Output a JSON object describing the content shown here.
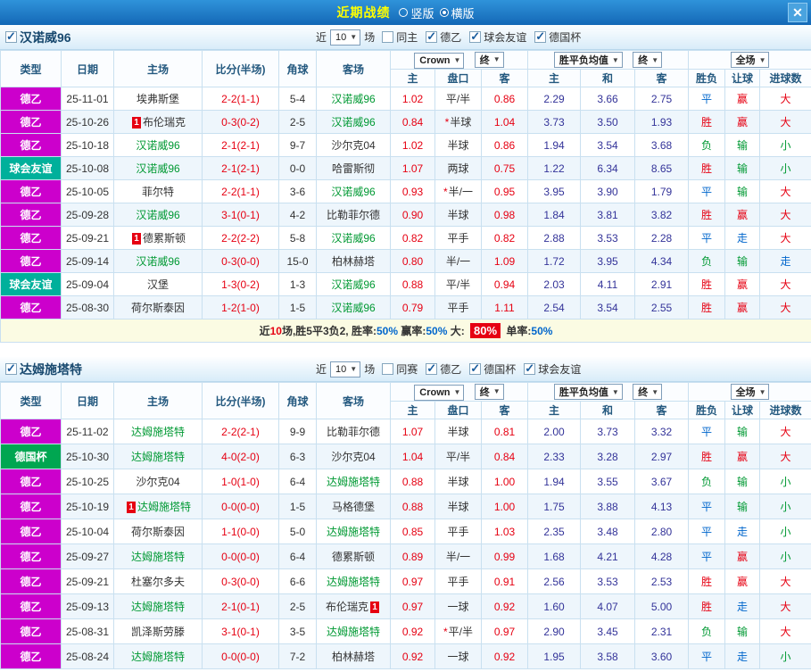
{
  "topbar": {
    "title": "近期战绩",
    "layout_options": [
      {
        "label": "竖版",
        "selected": false
      },
      {
        "label": "横版",
        "selected": true
      }
    ],
    "close": "✕"
  },
  "columns": {
    "type": "类型",
    "date": "日期",
    "home": "主场",
    "score": "比分(半场)",
    "corner": "角球",
    "away": "客场",
    "odds_group": "Crown",
    "odds_end": "终",
    "avg_group": "胜平负均值",
    "avg_end": "终",
    "full_group": "全场",
    "odds_sub": [
      "主",
      "盘口",
      "客"
    ],
    "avg_sub": [
      "主",
      "和",
      "客"
    ],
    "full_sub": [
      "胜负",
      "让球",
      "进球数"
    ]
  },
  "type_colors": {
    "德乙": "#cc00cc",
    "球会友谊": "#00b09b",
    "德国杯": "#00a651"
  },
  "result_colors": {
    "胜": "#e60012",
    "平": "#0066cc",
    "负": "#009933",
    "赢": "#e60012",
    "输": "#009933",
    "走": "#0066cc",
    "大": "#e60012",
    "小": "#009933"
  },
  "sections": [
    {
      "team": "汉诺威96",
      "near": "近",
      "count": "10",
      "games": "场",
      "filters": [
        {
          "label": "同主",
          "checked": false
        },
        {
          "label": "德乙",
          "checked": true
        },
        {
          "label": "球会友谊",
          "checked": true
        },
        {
          "label": "德国杯",
          "checked": true
        }
      ],
      "rows": [
        {
          "type": "德乙",
          "date": "25-11-01",
          "home": "埃弗斯堡",
          "home_team": false,
          "home_card": false,
          "score": "2-2(1-1)",
          "corner": "5-4",
          "away": "汉诺威96",
          "away_team": true,
          "away_card": false,
          "o1": "1.02",
          "star": false,
          "pan": "平/半",
          "o2": "0.86",
          "a1": "2.29",
          "a2": "3.66",
          "a3": "2.75",
          "r1": "平",
          "r2": "赢",
          "r3": "大"
        },
        {
          "type": "德乙",
          "date": "25-10-26",
          "home": "布伦瑞克",
          "home_team": false,
          "home_card": true,
          "score": "0-3(0-2)",
          "corner": "2-5",
          "away": "汉诺威96",
          "away_team": true,
          "away_card": false,
          "o1": "0.84",
          "star": true,
          "pan": "半球",
          "o2": "1.04",
          "a1": "3.73",
          "a2": "3.50",
          "a3": "1.93",
          "r1": "胜",
          "r2": "赢",
          "r3": "大"
        },
        {
          "type": "德乙",
          "date": "25-10-18",
          "home": "汉诺威96",
          "home_team": true,
          "home_card": false,
          "score": "2-1(2-1)",
          "corner": "9-7",
          "away": "沙尔克04",
          "away_team": false,
          "away_card": false,
          "o1": "1.02",
          "star": false,
          "pan": "半球",
          "o2": "0.86",
          "a1": "1.94",
          "a2": "3.54",
          "a3": "3.68",
          "r1": "负",
          "r2": "输",
          "r3": "小"
        },
        {
          "type": "球会友谊",
          "date": "25-10-08",
          "home": "汉诺威96",
          "home_team": true,
          "home_card": false,
          "score": "2-1(2-1)",
          "corner": "0-0",
          "away": "哈雷斯彻",
          "away_team": false,
          "away_card": false,
          "o1": "1.07",
          "star": false,
          "pan": "两球",
          "o2": "0.75",
          "a1": "1.22",
          "a2": "6.34",
          "a3": "8.65",
          "r1": "胜",
          "r2": "输",
          "r3": "小"
        },
        {
          "type": "德乙",
          "date": "25-10-05",
          "home": "菲尔特",
          "home_team": false,
          "home_card": false,
          "score": "2-2(1-1)",
          "corner": "3-6",
          "away": "汉诺威96",
          "away_team": true,
          "away_card": false,
          "o1": "0.93",
          "star": true,
          "pan": "半/一",
          "o2": "0.95",
          "a1": "3.95",
          "a2": "3.90",
          "a3": "1.79",
          "r1": "平",
          "r2": "输",
          "r3": "大"
        },
        {
          "type": "德乙",
          "date": "25-09-28",
          "home": "汉诺威96",
          "home_team": true,
          "home_card": false,
          "score": "3-1(0-1)",
          "corner": "4-2",
          "away": "比勒菲尔德",
          "away_team": false,
          "away_card": false,
          "o1": "0.90",
          "star": false,
          "pan": "半球",
          "o2": "0.98",
          "a1": "1.84",
          "a2": "3.81",
          "a3": "3.82",
          "r1": "胜",
          "r2": "赢",
          "r3": "大"
        },
        {
          "type": "德乙",
          "date": "25-09-21",
          "home": "德累斯顿",
          "home_team": false,
          "home_card": true,
          "score": "2-2(2-2)",
          "corner": "5-8",
          "away": "汉诺威96",
          "away_team": true,
          "away_card": false,
          "o1": "0.82",
          "star": false,
          "pan": "平手",
          "o2": "0.82",
          "a1": "2.88",
          "a2": "3.53",
          "a3": "2.28",
          "r1": "平",
          "r2": "走",
          "r3": "大"
        },
        {
          "type": "德乙",
          "date": "25-09-14",
          "home": "汉诺威96",
          "home_team": true,
          "home_card": false,
          "score": "0-3(0-0)",
          "corner": "15-0",
          "away": "柏林赫塔",
          "away_team": false,
          "away_card": false,
          "o1": "0.80",
          "star": false,
          "pan": "半/一",
          "o2": "1.09",
          "a1": "1.72",
          "a2": "3.95",
          "a3": "4.34",
          "r1": "负",
          "r2": "输",
          "r3": "走"
        },
        {
          "type": "球会友谊",
          "date": "25-09-04",
          "home": "汉堡",
          "home_team": false,
          "home_card": false,
          "score": "1-3(0-2)",
          "corner": "1-3",
          "away": "汉诺威96",
          "away_team": true,
          "away_card": false,
          "o1": "0.88",
          "star": false,
          "pan": "平/半",
          "o2": "0.94",
          "a1": "2.03",
          "a2": "4.11",
          "a3": "2.91",
          "r1": "胜",
          "r2": "赢",
          "r3": "大"
        },
        {
          "type": "德乙",
          "date": "25-08-30",
          "home": "荷尔斯泰因",
          "home_team": false,
          "home_card": false,
          "score": "1-2(1-0)",
          "corner": "1-5",
          "away": "汉诺威96",
          "away_team": true,
          "away_card": false,
          "o1": "0.79",
          "star": false,
          "pan": "平手",
          "o2": "1.11",
          "a1": "2.54",
          "a2": "3.54",
          "a3": "2.55",
          "r1": "胜",
          "r2": "赢",
          "r3": "大"
        }
      ],
      "summary": {
        "parts": [
          {
            "t": "近"
          },
          {
            "t": "10",
            "c": "red"
          },
          {
            "t": "场,胜5平3负2, 胜率:"
          },
          {
            "t": "50%",
            "c": "blue"
          },
          {
            "t": " 赢率:"
          },
          {
            "t": "50%",
            "c": "blue"
          },
          {
            "t": " 大: "
          },
          {
            "t": "80%",
            "badge": true
          },
          {
            "t": " 单率:"
          },
          {
            "t": "50%",
            "c": "blue"
          }
        ]
      }
    },
    {
      "team": "达姆施塔特",
      "near": "近",
      "count": "10",
      "games": "场",
      "filters": [
        {
          "label": "同赛",
          "checked": false
        },
        {
          "label": "德乙",
          "checked": true
        },
        {
          "label": "德国杯",
          "checked": true
        },
        {
          "label": "球会友谊",
          "checked": true
        }
      ],
      "rows": [
        {
          "type": "德乙",
          "date": "25-11-02",
          "home": "达姆施塔特",
          "home_team": true,
          "home_card": false,
          "score": "2-2(2-1)",
          "corner": "9-9",
          "away": "比勒菲尔德",
          "away_team": false,
          "away_card": false,
          "o1": "1.07",
          "star": false,
          "pan": "半球",
          "o2": "0.81",
          "a1": "2.00",
          "a2": "3.73",
          "a3": "3.32",
          "r1": "平",
          "r2": "输",
          "r3": "大"
        },
        {
          "type": "德国杯",
          "date": "25-10-30",
          "home": "达姆施塔特",
          "home_team": true,
          "home_card": false,
          "score": "4-0(2-0)",
          "corner": "6-3",
          "away": "沙尔克04",
          "away_team": false,
          "away_card": false,
          "o1": "1.04",
          "star": false,
          "pan": "平/半",
          "o2": "0.84",
          "a1": "2.33",
          "a2": "3.28",
          "a3": "2.97",
          "r1": "胜",
          "r2": "赢",
          "r3": "大"
        },
        {
          "type": "德乙",
          "date": "25-10-25",
          "home": "沙尔克04",
          "home_team": false,
          "home_card": false,
          "score": "1-0(1-0)",
          "corner": "6-4",
          "away": "达姆施塔特",
          "away_team": true,
          "away_card": false,
          "o1": "0.88",
          "star": false,
          "pan": "半球",
          "o2": "1.00",
          "a1": "1.94",
          "a2": "3.55",
          "a3": "3.67",
          "r1": "负",
          "r2": "输",
          "r3": "小"
        },
        {
          "type": "德乙",
          "date": "25-10-19",
          "home": "达姆施塔特",
          "home_team": true,
          "home_card": true,
          "score": "0-0(0-0)",
          "corner": "1-5",
          "away": "马格德堡",
          "away_team": false,
          "away_card": false,
          "o1": "0.88",
          "star": false,
          "pan": "半球",
          "o2": "1.00",
          "a1": "1.75",
          "a2": "3.88",
          "a3": "4.13",
          "r1": "平",
          "r2": "输",
          "r3": "小"
        },
        {
          "type": "德乙",
          "date": "25-10-04",
          "home": "荷尔斯泰因",
          "home_team": false,
          "home_card": false,
          "score": "1-1(0-0)",
          "corner": "5-0",
          "away": "达姆施塔特",
          "away_team": true,
          "away_card": false,
          "o1": "0.85",
          "star": false,
          "pan": "平手",
          "o2": "1.03",
          "a1": "2.35",
          "a2": "3.48",
          "a3": "2.80",
          "r1": "平",
          "r2": "走",
          "r3": "小"
        },
        {
          "type": "德乙",
          "date": "25-09-27",
          "home": "达姆施塔特",
          "home_team": true,
          "home_card": false,
          "score": "0-0(0-0)",
          "corner": "6-4",
          "away": "德累斯顿",
          "away_team": false,
          "away_card": false,
          "o1": "0.89",
          "star": false,
          "pan": "半/一",
          "o2": "0.99",
          "a1": "1.68",
          "a2": "4.21",
          "a3": "4.28",
          "r1": "平",
          "r2": "赢",
          "r3": "小"
        },
        {
          "type": "德乙",
          "date": "25-09-21",
          "home": "杜塞尔多夫",
          "home_team": false,
          "home_card": false,
          "score": "0-3(0-0)",
          "corner": "6-6",
          "away": "达姆施塔特",
          "away_team": true,
          "away_card": false,
          "o1": "0.97",
          "star": false,
          "pan": "平手",
          "o2": "0.91",
          "a1": "2.56",
          "a2": "3.53",
          "a3": "2.53",
          "r1": "胜",
          "r2": "赢",
          "r3": "大"
        },
        {
          "type": "德乙",
          "date": "25-09-13",
          "home": "达姆施塔特",
          "home_team": true,
          "home_card": false,
          "score": "2-1(0-1)",
          "corner": "2-5",
          "away": "布伦瑞克",
          "away_team": false,
          "away_card": true,
          "o1": "0.97",
          "star": false,
          "pan": "一球",
          "o2": "0.92",
          "a1": "1.60",
          "a2": "4.07",
          "a3": "5.00",
          "r1": "胜",
          "r2": "走",
          "r3": "大"
        },
        {
          "type": "德乙",
          "date": "25-08-31",
          "home": "凯泽斯劳滕",
          "home_team": false,
          "home_card": false,
          "score": "3-1(0-1)",
          "corner": "3-5",
          "away": "达姆施塔特",
          "away_team": true,
          "away_card": false,
          "o1": "0.92",
          "star": true,
          "pan": "平/半",
          "o2": "0.97",
          "a1": "2.90",
          "a2": "3.45",
          "a3": "2.31",
          "r1": "负",
          "r2": "输",
          "r3": "大"
        },
        {
          "type": "德乙",
          "date": "25-08-24",
          "home": "达姆施塔特",
          "home_team": true,
          "home_card": false,
          "score": "0-0(0-0)",
          "corner": "7-2",
          "away": "柏林赫塔",
          "away_team": false,
          "away_card": false,
          "o1": "0.92",
          "star": false,
          "pan": "一球",
          "o2": "0.92",
          "a1": "1.95",
          "a2": "3.58",
          "a3": "3.60",
          "r1": "平",
          "r2": "走",
          "r3": "小"
        }
      ],
      "summary": null
    }
  ]
}
